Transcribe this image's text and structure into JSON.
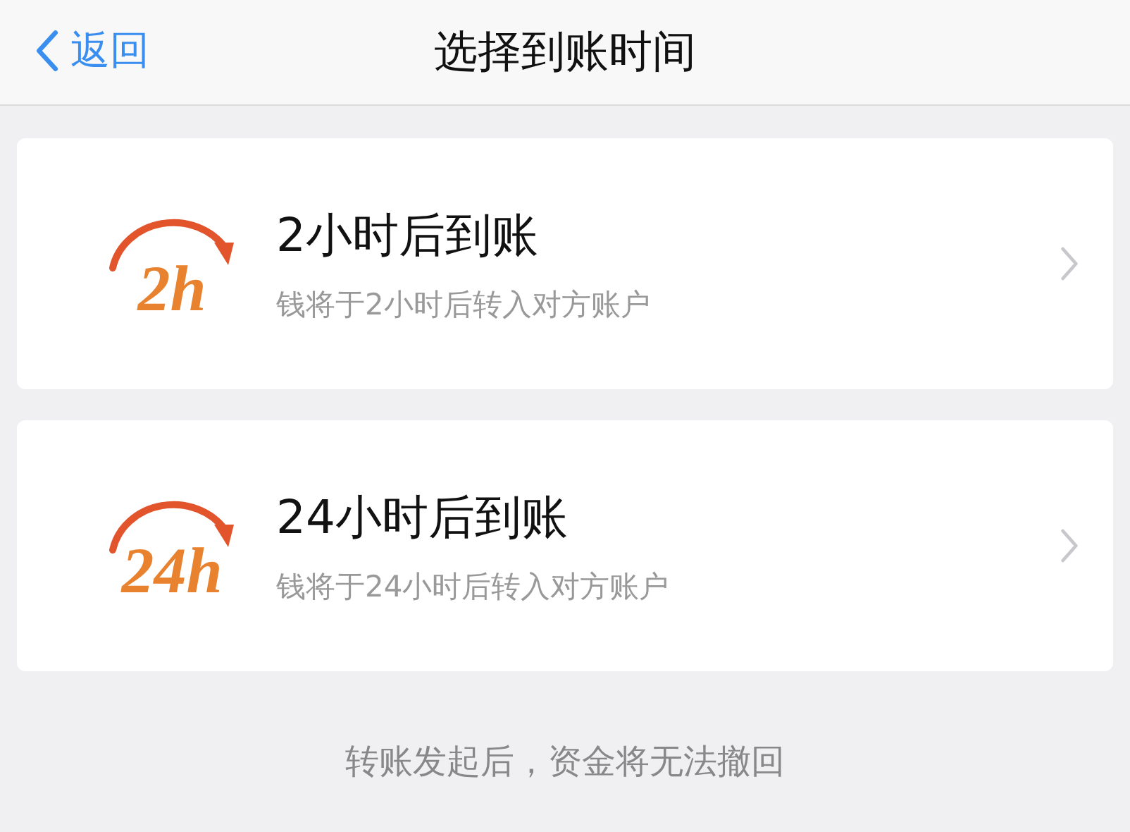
{
  "nav_bar": {
    "back": "返回",
    "title": "选择到账时间"
  },
  "options": [
    {
      "badge": "2h",
      "title": "2小时后到账",
      "description": "钱将于2小时后转入对方账户"
    },
    {
      "badge": "24h",
      "title": "24小时后到账",
      "description": "钱将于24小时后转入对方账户"
    }
  ],
  "footer_note": "转账发起后，资金将无法撤回"
}
